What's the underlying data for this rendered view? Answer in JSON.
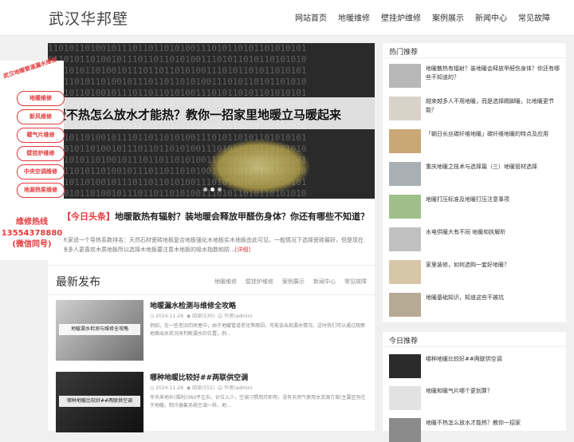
{
  "header": {
    "logo": "武汉华邦壁",
    "nav": [
      "网站首页",
      "地暖维修",
      "壁挂炉维修",
      "案例展示",
      "新闻中心",
      "常见故障"
    ]
  },
  "slider": {
    "title": "暖不热怎么放水才能热？教你一招家里地暖立马暖起来"
  },
  "headline": {
    "tag": "【今日头条】",
    "text": "地暖散热有辐射？装地暖会释放甲醛伤身体？你还有哪些不知道？"
  },
  "summary": {
    "text": "大家说一个导热系数排名：天然石材瓷砖地板复合地板强化木地板实木地板由此可见，一般情况下选择瓷砖最好，但是现在很多人更喜欢木质地板所以选择木地板要注意木地板的吸水指数和防...",
    "more": "[详细]"
  },
  "latest": {
    "title": "最新发布",
    "tabs": [
      "地暖维修",
      "壁挂炉维修",
      "案例展示",
      "新闻中心",
      "常见故障"
    ],
    "posts": [
      {
        "title": "地暖漏水检测与维修全攻略",
        "date": "2024-11-26",
        "views": "阅读(530)",
        "author": "作者(admin)",
        "desc": "例如，在一些老旧的房屋中，由于地暖管道老化等原因，可能会出现漏水情况。这时我们可以通过观察地面出水状况来判断漏水的位置。例...",
        "thumb_caption": "地暖漏水检测与维修全攻略"
      },
      {
        "title": "哪种地暖比较好##两联供空调",
        "date": "2024-11-26",
        "views": "阅读(551)",
        "author": "作者(admin)",
        "desc": "冬天来地长(福利)360平左右，价位入少，空调习惯用开即用，没有天然气使用水资源方案(主要区别在于地暖，制冷器氟系统空调一样。地...",
        "thumb_caption": "哪种地暖比较好##两联供空调"
      }
    ]
  },
  "hot": {
    "title": "热门推荐",
    "items": [
      "地暖散热有辐射？装地暖会释放甲醛伤身体？你还有哪些不知道的？",
      "越来越多人不用地暖，而是选择踢脚暖，比地暖更节能？",
      "「朝日长丝碳纤维地暖」碳纤维地暖的特点及应用",
      "重庆地暖之技术与选择篇（三）地暖管材选择",
      "地暖打压标准及地暖打压注意事项",
      "水电供暖大有不同 地暖和执解析",
      "家里装修，如何选购一套好地暖？",
      "地暖基础知识，知道这些不被坑"
    ]
  },
  "today": {
    "title": "今日推荐",
    "items": [
      "哪种地暖比较好##两联供空调",
      "地暖和暖气片哪个更划算？",
      "地暖不热怎么放水才能热？教你一招家"
    ]
  },
  "float": {
    "ribbon": "武汉地暖管道漏水维修",
    "buttons": [
      "地暖维修",
      "新风维修",
      "暖气片维修",
      "壁挂炉维修",
      "中央空调维修",
      "地源热泵维修"
    ],
    "hotline_label": "维修热线",
    "hotline_number": "13554378880",
    "hotline_note": "(微信同号)"
  },
  "colors": {
    "accent": "#e4393c",
    "background": "#f0f0f0"
  }
}
